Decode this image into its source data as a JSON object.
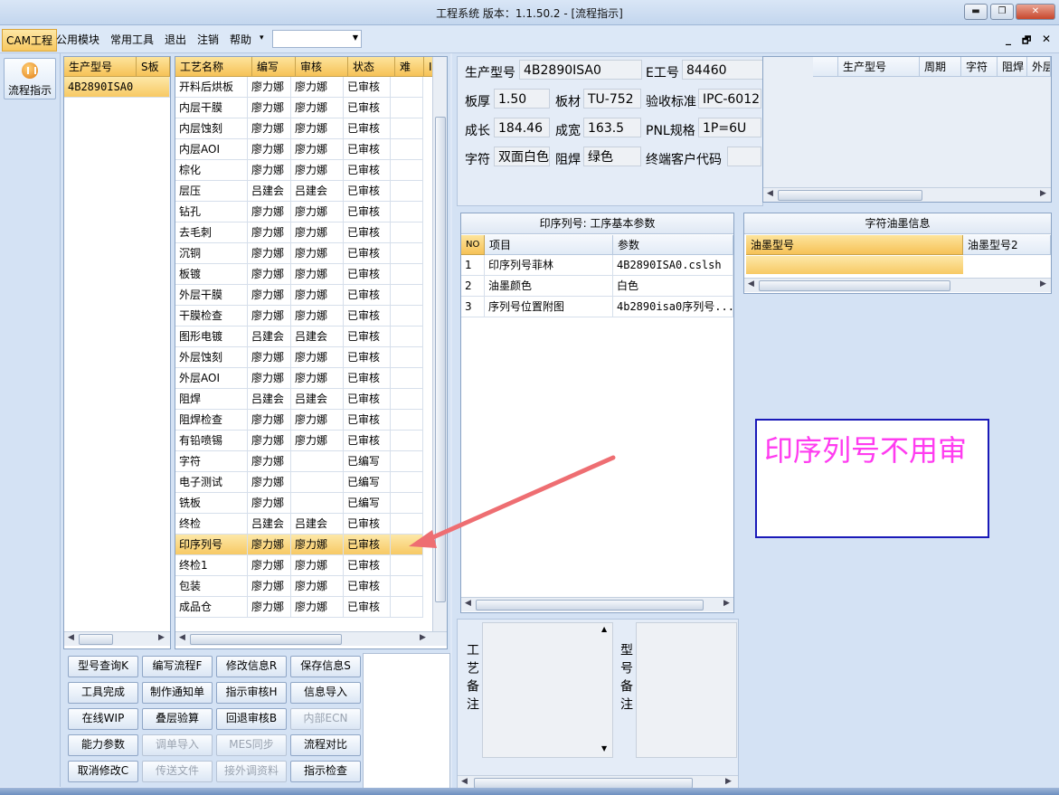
{
  "window": {
    "title": "工程系统   版本：1.1.50.2 - [流程指示]",
    "btn_min": "▬",
    "btn_max": "❐",
    "btn_close": "✕"
  },
  "menu": {
    "items": [
      "CAM工程",
      "公用模块",
      "常用工具",
      "退出",
      "注销",
      "帮助"
    ],
    "help_arrow": "▾",
    "combo_value": "",
    "mdi_min": "_",
    "mdi_restore": "🗗",
    "mdi_close": "✕"
  },
  "left_strip": {
    "flow_button_label": "流程指示"
  },
  "model_grid": {
    "headers": [
      "生产型号",
      "S板"
    ],
    "rows": [
      "4B2890ISA0"
    ]
  },
  "process_grid": {
    "headers": [
      "工艺名称",
      "编写",
      "审核",
      "状态",
      "难",
      "I"
    ],
    "selected_index": 22,
    "rows": [
      [
        "开料后烘板",
        "廖力娜",
        "廖力娜",
        "已审核"
      ],
      [
        "内层干膜",
        "廖力娜",
        "廖力娜",
        "已审核"
      ],
      [
        "内层蚀刻",
        "廖力娜",
        "廖力娜",
        "已审核"
      ],
      [
        "内层AOI",
        "廖力娜",
        "廖力娜",
        "已审核"
      ],
      [
        "棕化",
        "廖力娜",
        "廖力娜",
        "已审核"
      ],
      [
        "层压",
        "吕建会",
        "吕建会",
        "已审核"
      ],
      [
        "钻孔",
        "廖力娜",
        "廖力娜",
        "已审核"
      ],
      [
        "去毛刺",
        "廖力娜",
        "廖力娜",
        "已审核"
      ],
      [
        "沉铜",
        "廖力娜",
        "廖力娜",
        "已审核"
      ],
      [
        "板镀",
        "廖力娜",
        "廖力娜",
        "已审核"
      ],
      [
        "外层干膜",
        "廖力娜",
        "廖力娜",
        "已审核"
      ],
      [
        "干膜检查",
        "廖力娜",
        "廖力娜",
        "已审核"
      ],
      [
        "图形电镀",
        "吕建会",
        "吕建会",
        "已审核"
      ],
      [
        "外层蚀刻",
        "廖力娜",
        "廖力娜",
        "已审核"
      ],
      [
        "外层AOI",
        "廖力娜",
        "廖力娜",
        "已审核"
      ],
      [
        "阻焊",
        "吕建会",
        "吕建会",
        "已审核"
      ],
      [
        "阻焊检查",
        "廖力娜",
        "廖力娜",
        "已审核"
      ],
      [
        "有铅喷锡",
        "廖力娜",
        "廖力娜",
        "已审核"
      ],
      [
        "字符",
        "廖力娜",
        "",
        "已编写"
      ],
      [
        "电子测试",
        "廖力娜",
        "",
        "已编写"
      ],
      [
        "铣板",
        "廖力娜",
        "",
        "已编写"
      ],
      [
        "终检",
        "吕建会",
        "吕建会",
        "已审核"
      ],
      [
        "印序列号",
        "廖力娜",
        "廖力娜",
        "已审核"
      ],
      [
        "终检1",
        "廖力娜",
        "廖力娜",
        "已审核"
      ],
      [
        "包装",
        "廖力娜",
        "廖力娜",
        "已审核"
      ],
      [
        "成品仓",
        "廖力娜",
        "廖力娜",
        "已审核"
      ]
    ]
  },
  "buttons": [
    {
      "label": "型号查询K",
      "enabled": true
    },
    {
      "label": "编写流程F",
      "enabled": true
    },
    {
      "label": "修改信息R",
      "enabled": true
    },
    {
      "label": "保存信息S",
      "enabled": true
    },
    {
      "label": "工具完成",
      "enabled": true
    },
    {
      "label": "制作通知单",
      "enabled": true
    },
    {
      "label": "指示审核H",
      "enabled": true
    },
    {
      "label": "信息导入",
      "enabled": true
    },
    {
      "label": "在线WIP",
      "enabled": true
    },
    {
      "label": "叠层验算",
      "enabled": true
    },
    {
      "label": "回退审核B",
      "enabled": true
    },
    {
      "label": "内部ECN",
      "enabled": false
    },
    {
      "label": "能力参数",
      "enabled": true
    },
    {
      "label": "调单导入",
      "enabled": false
    },
    {
      "label": "MES同步",
      "enabled": false
    },
    {
      "label": "流程对比",
      "enabled": true
    },
    {
      "label": "取消修改C",
      "enabled": true
    },
    {
      "label": "传送文件",
      "enabled": false
    },
    {
      "label": "接外调资料",
      "enabled": false
    },
    {
      "label": "指示检查",
      "enabled": true
    }
  ],
  "info": {
    "model_label": "生产型号",
    "model_value": "4B2890ISA0",
    "e_label": "E工号",
    "e_value": "84460",
    "thickness_label": "板厚",
    "thickness_value": "1.50",
    "material_label": "板材",
    "material_value": "TU-752",
    "standard_label": "验收标准",
    "standard_value": "IPC-6012",
    "length_label": "成长",
    "length_value": "184.46",
    "width_label": "成宽",
    "width_value": "163.5",
    "pnl_label": "PNL规格",
    "pnl_value": "1P=6U",
    "char_label": "字符",
    "char_value": "双面白色",
    "mask_label": "阻焊",
    "mask_value": "绿色",
    "customer_label": "终端客户代码",
    "customer_value": ""
  },
  "cycle_grid": {
    "headers": [
      "生产型号",
      "周期",
      "字符",
      "阻焊",
      "外层"
    ]
  },
  "params_panel": {
    "title": "印序列号: 工序基本参数",
    "headers": [
      "NO",
      "项目",
      "参数"
    ],
    "rows": [
      [
        "1",
        "印序列号菲林",
        "4B2890ISA0.cslsh"
      ],
      [
        "2",
        "油墨颜色",
        "白色"
      ],
      [
        "3",
        "序列号位置附图",
        "4b2890isa0序列号..."
      ]
    ]
  },
  "ink_panel": {
    "title": "字符油墨信息",
    "headers": [
      "油墨型号",
      "油墨型号2"
    ]
  },
  "annotation": {
    "text": "印序列号不用审",
    "color": "#ff3cf0",
    "border_color": "#1a1ab8"
  },
  "remarks": {
    "process_label": "工艺备注",
    "model_label": "型号备注"
  },
  "colors": {
    "header_orange": "#f6c257",
    "arrow": "#ee6e72"
  }
}
